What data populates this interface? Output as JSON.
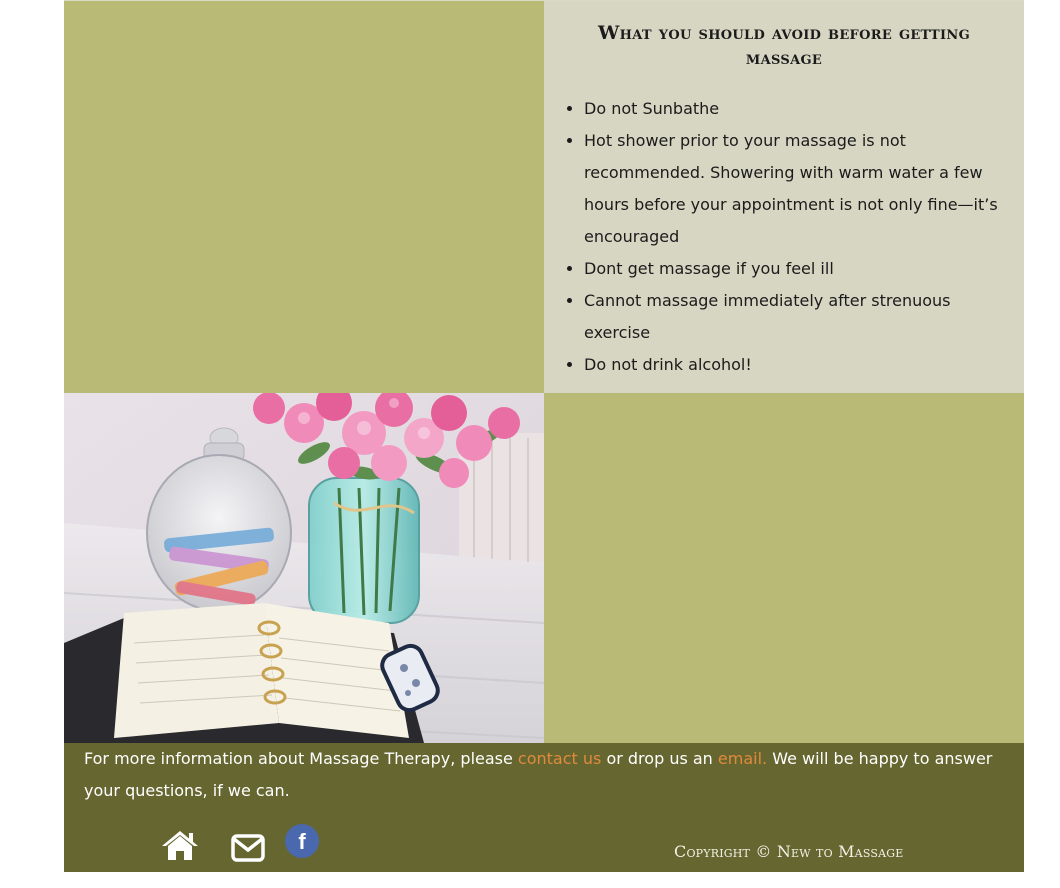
{
  "info": {
    "title": "What you should avoid before getting massage",
    "items": [
      "Do not Sunbathe",
      "Hot shower prior to your massage is not recommended. Showering with warm water a few hours before your appointment is not only fine—it’s encouraged",
      "Dont get massage if you feel ill",
      "Cannot massage immediately after strenuous exercise",
      "Do not drink alcohol!"
    ]
  },
  "footer": {
    "text_before": "For more information about Massage Therapy, please ",
    "contact_link": "contact us",
    "text_middle": " or drop us an ",
    "email_link": "email.",
    "text_after": " We will be happy to answer your questions, if we can.",
    "icons": [
      "home-icon",
      "envelope-icon",
      "facebook-icon"
    ],
    "facebook_letter": "f",
    "copyright": "Copyright © New to Massage"
  },
  "colors": {
    "olive_light": "#b9ba76",
    "panel_gray": "#d6d6c3",
    "footer_olive": "#666630",
    "link_orange": "#e08a3c",
    "facebook_blue": "#4a68ad"
  }
}
